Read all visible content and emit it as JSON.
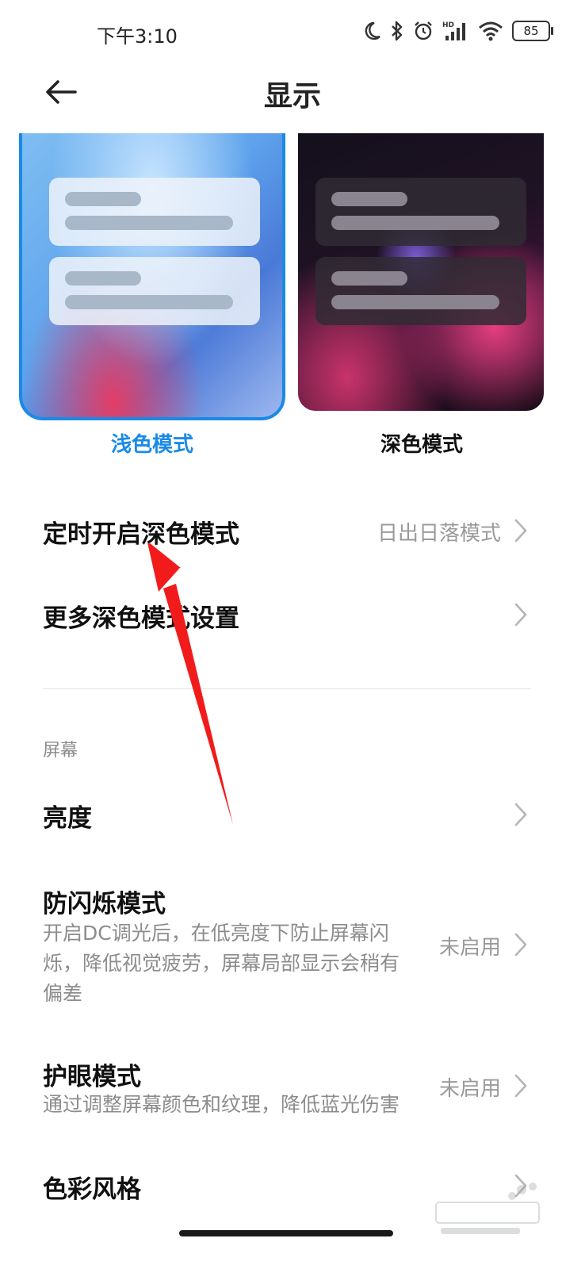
{
  "status_bar": {
    "time": "下午3:10",
    "battery": "85",
    "icons": [
      "moon-icon",
      "bluetooth-icon",
      "alarm-icon",
      "hd-signal-icon",
      "wifi-icon",
      "battery-icon"
    ]
  },
  "header": {
    "title": "显示",
    "back_icon": "back-arrow-icon"
  },
  "theme_options": [
    {
      "label": "浅色模式",
      "selected": true
    },
    {
      "label": "深色模式",
      "selected": false
    }
  ],
  "dark_mode_rows": [
    {
      "title": "定时开启深色模式",
      "value": "日出日落模式"
    },
    {
      "title": "更多深色模式设置",
      "value": ""
    }
  ],
  "screen_section": {
    "header": "屏幕",
    "rows": [
      {
        "title": "亮度",
        "subtitle": "",
        "value": ""
      },
      {
        "title": "防闪烁模式",
        "subtitle_lines": [
          "开启DC调光后，在低亮度下防止屏幕闪",
          "烁，降低视觉疲劳，屏幕局部显示会稍有",
          "偏差"
        ],
        "value": "未启用"
      },
      {
        "title": "护眼模式",
        "subtitle_lines": [
          "通过调整屏幕颜色和纹理，降低蓝光伤害"
        ],
        "value": "未启用"
      },
      {
        "title": "色彩风格",
        "subtitle": "",
        "value": ""
      }
    ]
  },
  "colors": {
    "accent": "#1a8ae6",
    "annotation_arrow": "#f21b1b",
    "secondary_text": "#9a9a9a"
  }
}
